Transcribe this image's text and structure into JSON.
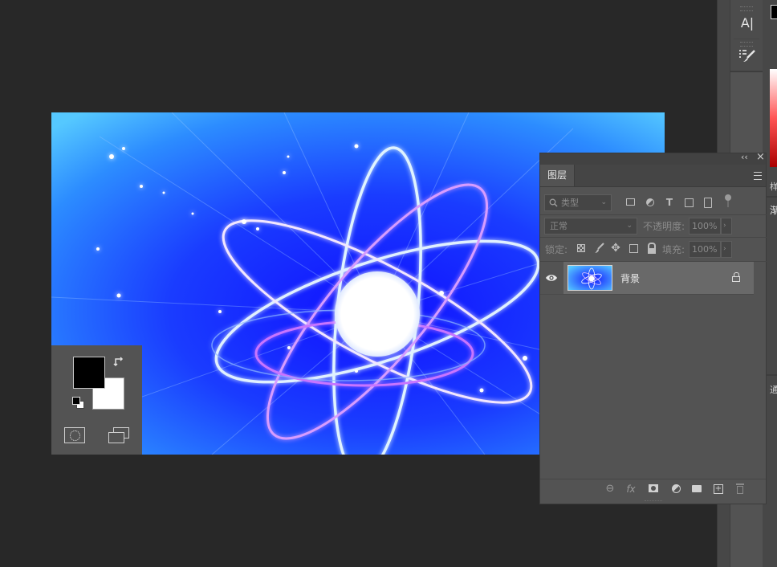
{
  "right_toolbar": {
    "type_tool_label": "A|",
    "tools": [
      "type-tool",
      "brush-preset-tool"
    ]
  },
  "color_tools": {
    "foreground": "#000000",
    "background": "#ffffff"
  },
  "layers_panel": {
    "tab_title": "图层",
    "collapse_glyph": "‹‹",
    "close_glyph": "×",
    "filter": {
      "label": "类型"
    },
    "filter_icons": [
      "image-filter-icon",
      "adjustment-filter-icon",
      "type-filter-icon",
      "shape-filter-icon",
      "smart-object-filter-icon",
      "filter-toggle-icon"
    ],
    "blend_mode": "正常",
    "opacity_label": "不透明度:",
    "opacity_value": "100%",
    "lock_label": "锁定:",
    "fill_label": "填充:",
    "fill_value": "100%",
    "layers": [
      {
        "name": "背景",
        "visible": true,
        "locked": true
      }
    ],
    "footer_icons": [
      "link-layers-icon",
      "fx-icon",
      "add-mask-icon",
      "adjustment-layer-icon",
      "group-folder-icon",
      "new-layer-icon",
      "delete-layer-icon"
    ],
    "fx_label": "fx"
  },
  "far_right": {
    "labels": [
      "样",
      "渐",
      "通"
    ]
  }
}
